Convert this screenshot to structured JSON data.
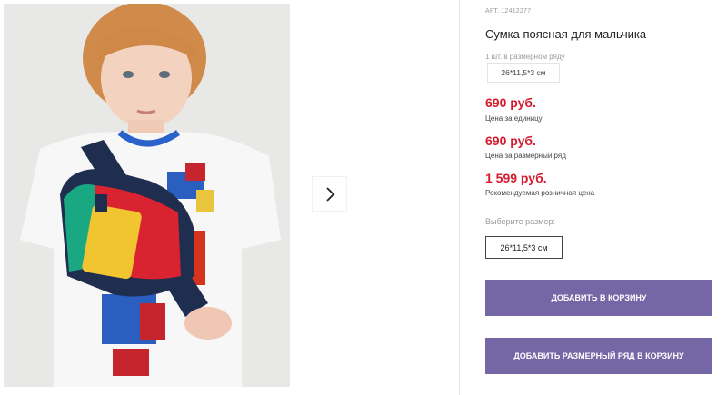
{
  "gallery": {
    "photo_alt": "",
    "next_icon": "chevron-right-icon"
  },
  "product": {
    "article": "АРТ. 12412277",
    "title": "Сумка поясная для мальчика",
    "set_caption": "1 шт. в размерном ряду",
    "set_value": "26*11,5*3 см"
  },
  "prices": [
    {
      "amount": "690 руб.",
      "label": "Цена за единицу"
    },
    {
      "amount": "690 руб.",
      "label": "Цена за размерный ряд"
    },
    {
      "amount": "1 599 руб.",
      "label": "Рекомендуемая розничная цена"
    }
  ],
  "size": {
    "caption": "Выберите размер:",
    "selected": "26*11,5*3 см"
  },
  "buttons": {
    "add_to_cart": "ДОБАВИТЬ В КОРЗИНУ",
    "add_size_row": "ДОБАВИТЬ РАЗМЕРНЫЙ РЯД В КОРЗИНУ"
  },
  "colors": {
    "price": "#d51b2d",
    "button": "#7566a6"
  }
}
